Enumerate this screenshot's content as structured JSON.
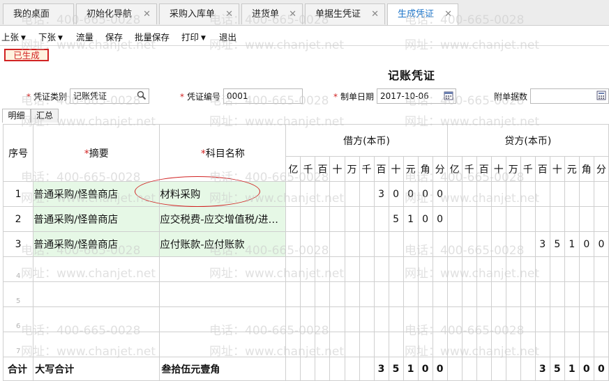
{
  "tabs": [
    {
      "label": "我的桌面",
      "closable": false,
      "active": false
    },
    {
      "label": "初始化导航",
      "closable": true,
      "active": false
    },
    {
      "label": "采购入库单",
      "closable": true,
      "active": false
    },
    {
      "label": "进货单",
      "closable": true,
      "active": false
    },
    {
      "label": "单据生凭证",
      "closable": true,
      "active": false
    },
    {
      "label": "生成凭证",
      "closable": true,
      "active": true
    }
  ],
  "toolbar": {
    "prev": "上张",
    "next": "下张",
    "flow": "流量",
    "save": "保存",
    "batch_save": "批量保存",
    "print": "打印",
    "exit": "退出"
  },
  "status_badge": "已生成",
  "title": "记账凭证",
  "form": {
    "type_label": "凭证类别",
    "type_value": "记账凭证",
    "number_label": "凭证编号",
    "number_value": "0001",
    "date_label": "制单日期",
    "date_value": "2017-10-06",
    "attach_label": "附单据数",
    "attach_value": ""
  },
  "subtabs": [
    "明细",
    "汇总"
  ],
  "table": {
    "col_seq": "序号",
    "col_summary": "摘要",
    "col_account": "科目名称",
    "col_debit": "借方(本币)",
    "col_credit": "贷方(本币)",
    "digit_units": [
      "亿",
      "千",
      "百",
      "十",
      "万",
      "千",
      "百",
      "十",
      "元",
      "角",
      "分"
    ],
    "rows": [
      {
        "seq": "1",
        "summary": "普通采购/怪兽商店",
        "account": "材料采购",
        "debit": "300.0",
        "credit": ""
      },
      {
        "seq": "2",
        "summary": "普通采购/怪兽商店",
        "account": "应交税费-应交增值税/进项税额",
        "debit": "51.0",
        "credit": ""
      },
      {
        "seq": "3",
        "summary": "普通采购/怪兽商店",
        "account": "应付账款-应付账款",
        "debit": "",
        "credit": "351.0"
      },
      {
        "seq": "4",
        "summary": "",
        "account": "",
        "debit": "",
        "credit": ""
      },
      {
        "seq": "5",
        "summary": "",
        "account": "",
        "debit": "",
        "credit": ""
      },
      {
        "seq": "6",
        "summary": "",
        "account": "",
        "debit": "",
        "credit": ""
      },
      {
        "seq": "7",
        "summary": "",
        "account": "",
        "debit": "",
        "credit": ""
      }
    ],
    "total_label": "合计",
    "total_caps_label": "大写合计",
    "total_caps_value": "叁拾伍元壹角",
    "total_debit": "351.0",
    "total_credit": "351.0"
  },
  "watermark": {
    "phone": "电话：400-665-0028",
    "site": "网址：www.chanjet.net"
  },
  "colors": {
    "accent": "#1a73c8",
    "required": "#d12222",
    "summary_bg": "#e6f8e6",
    "badge_bg": "#fff3e0"
  }
}
